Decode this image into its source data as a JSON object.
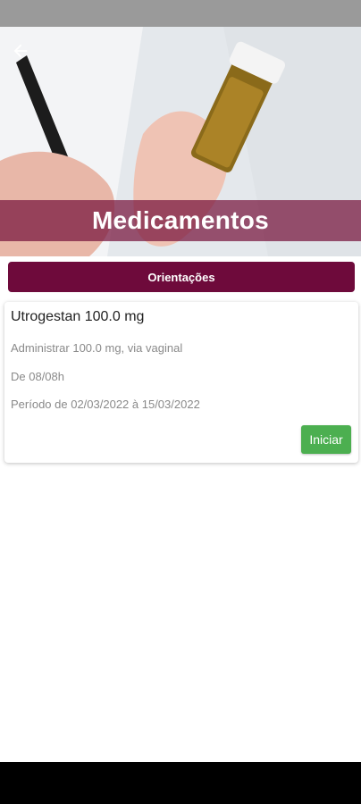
{
  "header": {
    "title": "Medicamentos",
    "back_icon": "arrow-left-icon"
  },
  "orientations_button": {
    "label": "Orientações"
  },
  "medications": [
    {
      "name": "Utrogestan 100.0 mg",
      "administration": "Administrar 100.0 mg, via vaginal",
      "frequency": "De 08/08h",
      "period": "Período de 02/03/2022  à 15/03/2022",
      "action_label": "Iniciar"
    }
  ],
  "colors": {
    "primary": "#6e0a3b",
    "title_band": "#76143c",
    "action": "#4caf50"
  }
}
